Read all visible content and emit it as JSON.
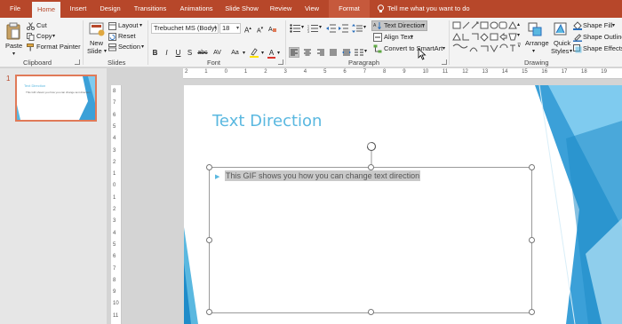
{
  "tabs": [
    {
      "label": "File"
    },
    {
      "label": "Home"
    },
    {
      "label": "Insert"
    },
    {
      "label": "Design"
    },
    {
      "label": "Transitions"
    },
    {
      "label": "Animations"
    },
    {
      "label": "Slide Show"
    },
    {
      "label": "Review"
    },
    {
      "label": "View"
    },
    {
      "label": "Format"
    }
  ],
  "tell_me": "Tell me what you want to do",
  "clipboard": {
    "paste": "Paste",
    "cut": "Cut",
    "copy": "Copy",
    "format_painter": "Format Painter",
    "group": "Clipboard"
  },
  "slides_group": {
    "new_slide_1": "New",
    "new_slide_2": "Slide",
    "layout": "Layout",
    "reset": "Reset",
    "section": "Section",
    "group": "Slides"
  },
  "font": {
    "family": "Trebuchet MS (Body)",
    "size": "18",
    "bold": "B",
    "italic": "I",
    "underline": "U",
    "shadow": "S",
    "strike": "abc",
    "spacing": "AV",
    "case": "Aa",
    "font_color": "A",
    "group": "Font"
  },
  "paragraph": {
    "text_direction": "Text Direction",
    "align_text": "Align Text",
    "convert_smartart": "Convert to SmartArt",
    "group": "Paragraph"
  },
  "drawing": {
    "arrange": "Arrange",
    "quick_styles_1": "Quick",
    "quick_styles_2": "Styles",
    "shape_fill": "Shape Fill",
    "shape_outline": "Shape Outline",
    "shape_effects": "Shape Effects",
    "group": "Drawing"
  },
  "thumbnail": {
    "number": "1",
    "title": "Text Direction",
    "body": "This GIF shows you how you can change text direction"
  },
  "ruler_h": [
    "2",
    "1",
    "0",
    "1",
    "2",
    "3",
    "4",
    "5",
    "6",
    "7",
    "8",
    "9",
    "10",
    "11",
    "12",
    "13",
    "14",
    "15",
    "16",
    "17",
    "18",
    "19"
  ],
  "ruler_v": [
    "8",
    "7",
    "6",
    "5",
    "4",
    "3",
    "2",
    "1",
    "0",
    "1",
    "2",
    "3",
    "4",
    "5",
    "6",
    "7",
    "8",
    "9",
    "10",
    "11"
  ],
  "slide": {
    "title": "Text Direction",
    "bullet": "This GIF shows you how you can change text direction"
  },
  "colors": {
    "accent": "#b7472a",
    "title_blue": "#5ab8e0"
  }
}
